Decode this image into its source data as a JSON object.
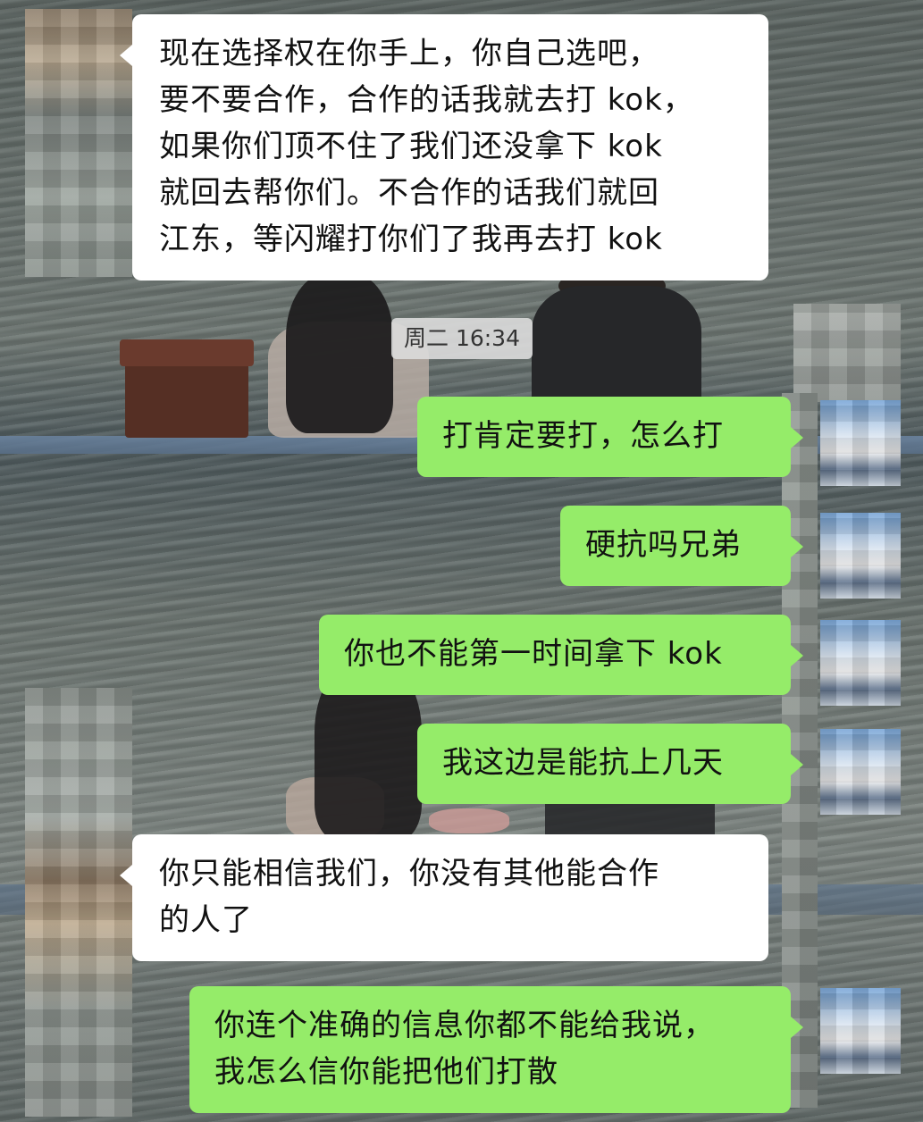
{
  "timestamp": "周二 16:34",
  "messages": [
    {
      "side": "in",
      "text": "现在选择权在你手上，你自己选吧，\n要不要合作，合作的话我就去打 kok，\n如果你们顶不住了我们还没拿下 kok\n就回去帮你们。不合作的话我们就回\n江东，等闪耀打你们了我再去打 kok"
    },
    {
      "side": "out",
      "text": "打肯定要打，怎么打"
    },
    {
      "side": "out",
      "text": "硬抗吗兄弟"
    },
    {
      "side": "out",
      "text": "你也不能第一时间拿下 kok"
    },
    {
      "side": "out",
      "text": "我这边是能抗上几天"
    },
    {
      "side": "in",
      "text": "你只能相信我们，你没有其他能合作\n的人了"
    },
    {
      "side": "out",
      "text": "你连个准确的信息你都不能给我说，\n我怎么信你能把他们打散"
    }
  ],
  "colors": {
    "outgoing_bubble": "#95ec69",
    "incoming_bubble": "#ffffff",
    "timestamp_bg": "#dcdcdc"
  }
}
